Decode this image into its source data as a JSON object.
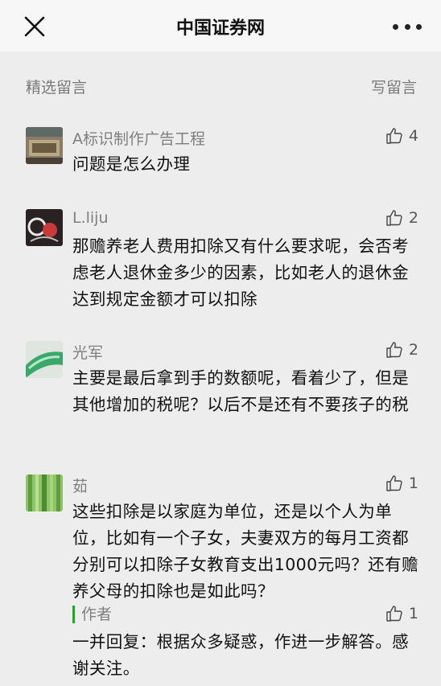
{
  "nav": {
    "title": "中国证券网"
  },
  "section": {
    "title": "精选留言",
    "write_label": "写留言"
  },
  "comments": [
    {
      "name": "A标识制作广告工程",
      "likes": "4",
      "text": "问题是怎么办理"
    },
    {
      "name": "L.liju",
      "likes": "2",
      "text": "那赡养老人费用扣除又有什么要求呢，会否考虑老人退休金多少的因素，比如老人的退休金达到规定金额才可以扣除"
    },
    {
      "name": "光军",
      "likes": "2",
      "text": "主要是最后拿到手的数额呢，看着少了，但是其他增加的税呢？以后不是还有不要孩子的税"
    },
    {
      "name": "茹",
      "likes": "1",
      "text": "这些扣除是以家庭为单位，还是以个人为单位，比如有一个子女，夫妻双方的每月工资都分别可以扣除子女教育支出1000元吗？还有赡养父母的扣除也是如此吗？"
    }
  ],
  "reply": {
    "author_label": "作者",
    "likes": "1",
    "text": "一并回复：根据众多疑惑，作进一步解答。感谢关注。"
  }
}
